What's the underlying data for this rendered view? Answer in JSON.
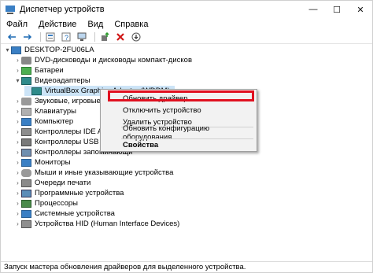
{
  "window": {
    "title": "Диспетчер устройств",
    "controls": {
      "minimize": "—",
      "maximize": "☐",
      "close": "✕"
    }
  },
  "menu": [
    "Файл",
    "Действие",
    "Вид",
    "Справка"
  ],
  "toolbar_icons": [
    "back-arrow-icon",
    "forward-arrow-icon",
    "properties-icon",
    "help-icon",
    "scan-hardware-icon",
    "update-driver-icon",
    "uninstall-icon",
    "download-icon"
  ],
  "tree": {
    "root": "DESKTOP-2FU06LA",
    "items": [
      "DVD-дисководы и дисководы компакт-дисков",
      "Батареи",
      "Видеоадаптеры",
      "VirtualBox Graphics Adapter (WDDM)",
      "Звуковые, игровые и видеоу",
      "Клавиатуры",
      "Компьютер",
      "Контроллеры IDE ATA/ATAPI",
      "Контроллеры USB",
      "Контроллеры запоминающи",
      "Мониторы",
      "Мыши и иные указывающие устройства",
      "Очереди печати",
      "Программные устройства",
      "Процессоры",
      "Системные устройства",
      "Устройства HID (Human Interface Devices)"
    ]
  },
  "context_menu": {
    "update_driver": "Обновить драйвер",
    "disable_device": "Отключить устройство",
    "uninstall_device": "Удалить устройство",
    "scan_hardware": "Обновить конфигурацию оборудования",
    "properties": "Свойства"
  },
  "status": "Запуск мастера обновления драйверов для выделенного устройства.",
  "colors": {
    "highlight": "#e01020",
    "selection": "#cce4f7",
    "accent": "#1f6fc0"
  }
}
